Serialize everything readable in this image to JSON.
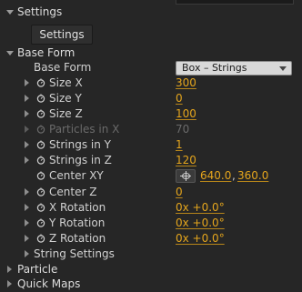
{
  "groups": {
    "settings": {
      "label": "Settings",
      "button_label": "Settings"
    },
    "base_form": {
      "label": "Base Form"
    },
    "particle": {
      "label": "Particle"
    },
    "quick_maps": {
      "label": "Quick Maps"
    }
  },
  "base_form_select": {
    "label": "Base Form",
    "value": "Box – Strings"
  },
  "params": {
    "size_x": {
      "label": "Size X",
      "value": "300"
    },
    "size_y": {
      "label": "Size Y",
      "value": "0"
    },
    "size_z": {
      "label": "Size Z",
      "value": "100"
    },
    "particles_in_x": {
      "label": "Particles in X",
      "value": "70"
    },
    "strings_in_y": {
      "label": "Strings in Y",
      "value": "1"
    },
    "strings_in_z": {
      "label": "Strings in Z",
      "value": "120"
    },
    "center_xy": {
      "label": "Center XY",
      "value_x": "640.0",
      "sep": ",",
      "value_y": "360.0"
    },
    "center_z": {
      "label": "Center Z",
      "value": "0"
    },
    "x_rotation": {
      "label": "X Rotation",
      "value": "0x +0.0°"
    },
    "y_rotation": {
      "label": "Y Rotation",
      "value": "0x +0.0°"
    },
    "z_rotation": {
      "label": "Z Rotation",
      "value": "0x +0.0°"
    }
  },
  "string_settings": {
    "label": "String Settings"
  },
  "icons": {
    "expand": "triangle-right-icon",
    "collapse": "triangle-down-icon",
    "stopwatch": "stopwatch-icon",
    "crosshair": "crosshair-icon"
  }
}
